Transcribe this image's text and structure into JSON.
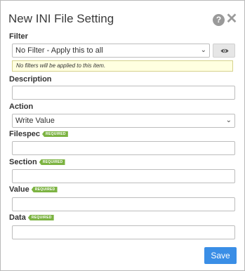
{
  "dialog": {
    "title": "New INI File Setting",
    "help_icon": "question-circle-icon",
    "close_icon": "close-icon"
  },
  "filter": {
    "label": "Filter",
    "selected": "No Filter - Apply this to all",
    "view_icon": "eye-icon",
    "notice": "No filters will be applied to this item."
  },
  "description": {
    "label": "Description",
    "value": ""
  },
  "action": {
    "label": "Action",
    "selected": "Write Value"
  },
  "filespec": {
    "label": "Filespec",
    "badge": "REQUIRED",
    "value": ""
  },
  "section": {
    "label": "Section",
    "badge": "REQUIRED",
    "value": ""
  },
  "value_field": {
    "label": "Value",
    "badge": "REQUIRED",
    "value": ""
  },
  "data_field": {
    "label": "Data",
    "badge": "REQUIRED",
    "value": ""
  },
  "footer": {
    "save_label": "Save"
  },
  "colors": {
    "accent": "#3a8ee6",
    "required_badge": "#7cb342",
    "notice_background": "#ffffe0"
  }
}
